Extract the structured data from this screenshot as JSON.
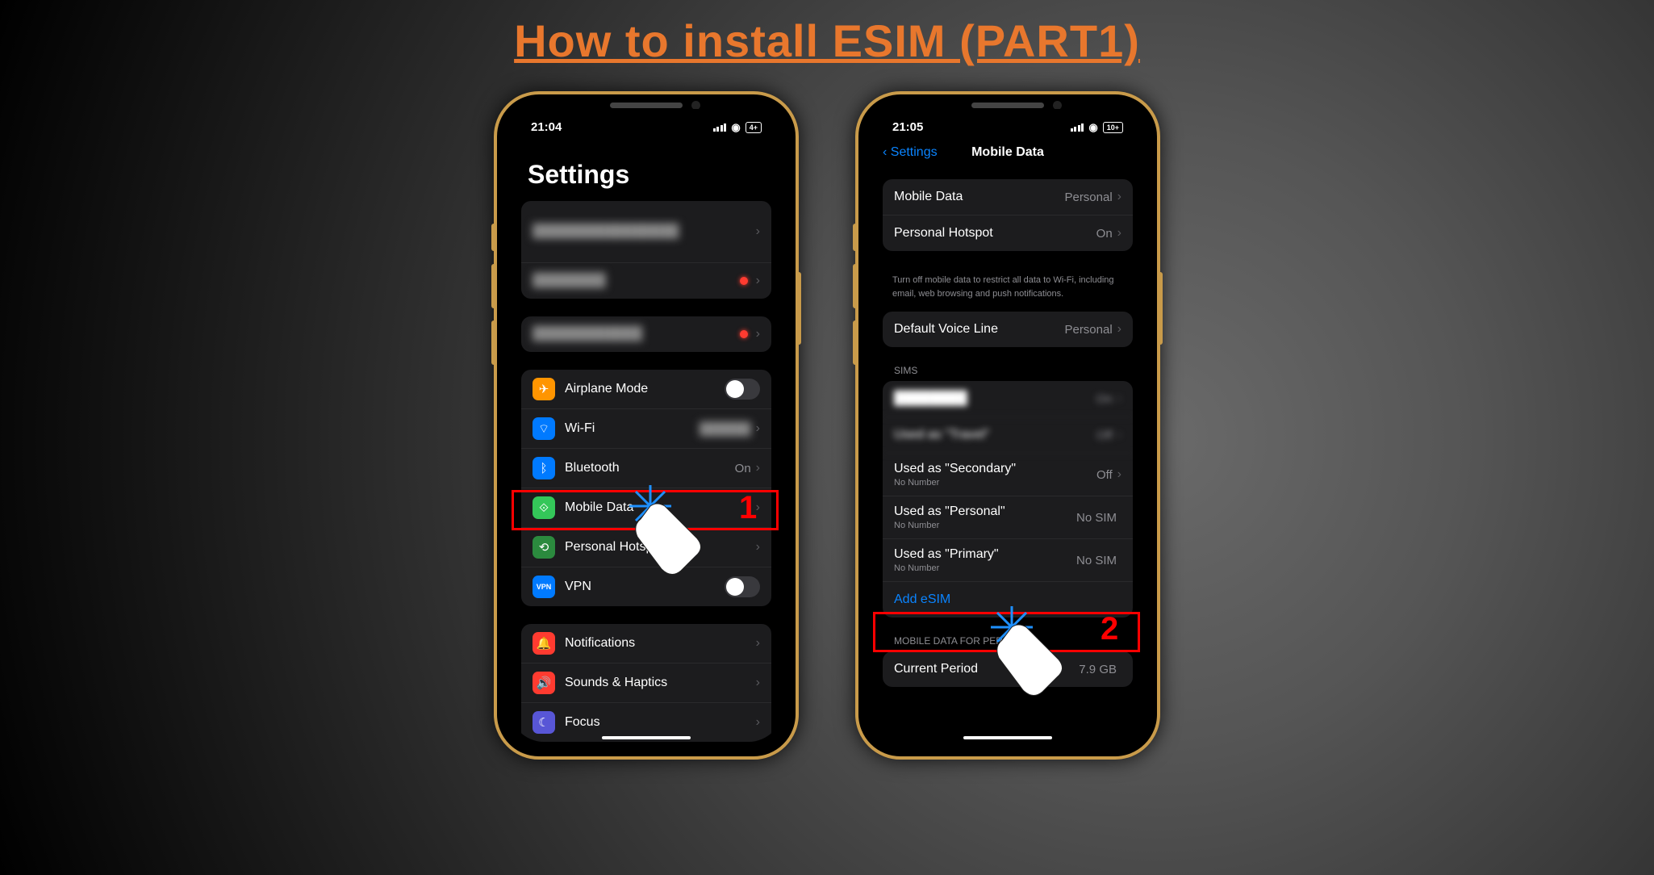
{
  "title": "How to install ESIM (PART1)",
  "phone1": {
    "time": "21:04",
    "battery": "4+",
    "heading": "Settings",
    "rows": {
      "airplane": "Airplane Mode",
      "wifi": "Wi-Fi",
      "bluetooth": "Bluetooth",
      "bluetooth_val": "On",
      "mobile": "Mobile Data",
      "hotspot": "Personal Hotspot",
      "vpn": "VPN",
      "notifications": "Notifications",
      "sounds": "Sounds & Haptics",
      "focus": "Focus"
    },
    "step": "1"
  },
  "phone2": {
    "time": "21:05",
    "battery": "10+",
    "back": "Settings",
    "title": "Mobile Data",
    "group1": {
      "mobile": "Mobile Data",
      "mobile_val": "Personal",
      "hotspot": "Personal Hotspot",
      "hotspot_val": "On"
    },
    "help": "Turn off mobile data to restrict all data to Wi-Fi, including email, web browsing and push notifications.",
    "group2": {
      "voice": "Default Voice Line",
      "voice_val": "Personal"
    },
    "sims_header": "SIMs",
    "sims": {
      "r1_val": "On",
      "r2_label": "Used as \"Travel\"",
      "r2_val": "Off",
      "r3_label": "Used as \"Secondary\"",
      "r3_sub": "No Number",
      "r3_val": "Off",
      "r4_label": "Used as \"Personal\"",
      "r4_sub": "No Number",
      "r4_val": "No SIM",
      "r5_label": "Used as \"Primary\"",
      "r5_sub": "No Number",
      "r5_val": "No SIM",
      "add": "Add eSIM"
    },
    "usage_header": "MOBILE DATA FOR PERSONAL",
    "usage": {
      "period": "Current Period",
      "period_val": "7.9 GB"
    },
    "step": "2"
  }
}
